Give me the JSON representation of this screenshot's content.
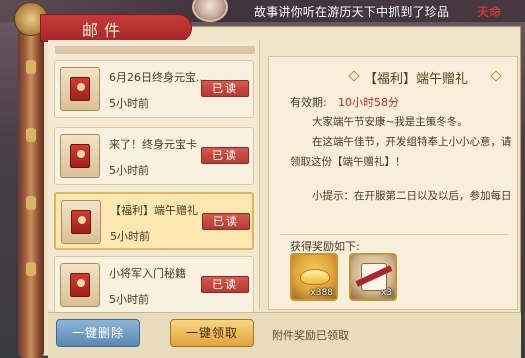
{
  "banner": {
    "text": "故事讲你听在游历天下中抓到了珍品",
    "text_red": "天命"
  },
  "window": {
    "title": "邮件"
  },
  "mail_list": [
    {
      "title": "6月26日终身元宝...",
      "time": "5小时前",
      "status": "已读",
      "selected": false
    },
    {
      "title": "来了！终身元宝卡",
      "time": "5小时前",
      "status": "已读",
      "selected": false
    },
    {
      "title": "【福利】端午赠礼",
      "time": "5小时前",
      "status": "已读",
      "selected": true
    },
    {
      "title": "小将军入门秘籍",
      "time": "5小时前",
      "status": "已读",
      "selected": false
    }
  ],
  "buttons": {
    "delete_all": "一键删除",
    "claim_all": "一键领取"
  },
  "detail": {
    "title": "【福利】端午赠礼",
    "validity_label": "有效期:",
    "validity_value": "10小时58分",
    "body_lines": [
      "大家端午节安康~我是主策冬冬。",
      "在这端午佳节，开发组特奉上小小心意，请",
      "领取这份【端午赠礼】！",
      "小提示：在开服第二日以及以后，参加每日"
    ],
    "reward_label": "获得奖励如下:",
    "rewards": [
      {
        "icon": "gold-ingot-icon",
        "qty": "x388"
      },
      {
        "icon": "scroll-icon",
        "qty": "x3"
      }
    ],
    "claimed_status": "附件奖励已领取"
  },
  "colors": {
    "accent_red": "#d22b25",
    "tab_red": "#a9262a",
    "panel": "#f7efda"
  }
}
